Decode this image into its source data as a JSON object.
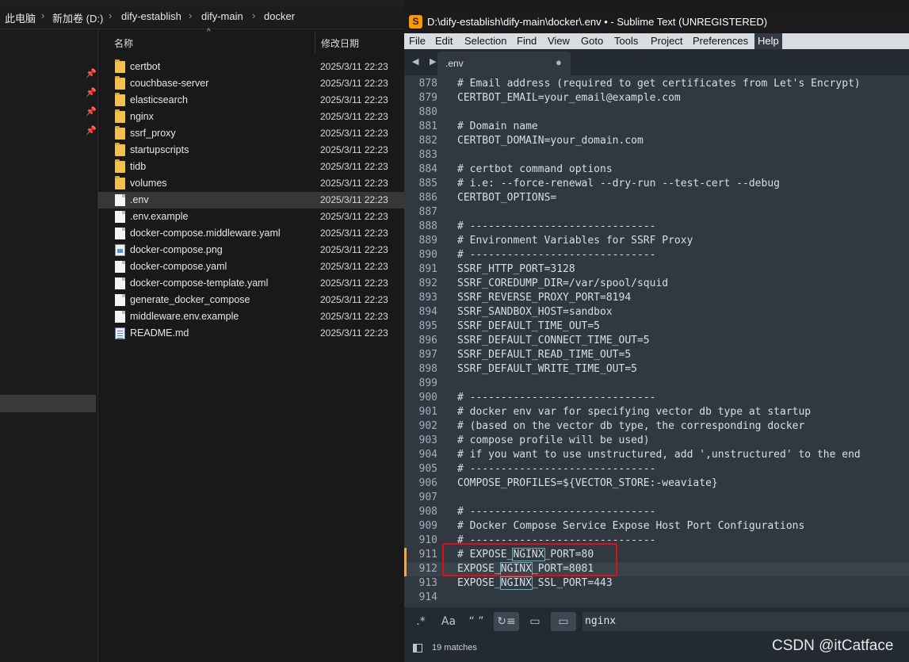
{
  "explorer": {
    "breadcrumb": [
      "此电脑",
      "新加卷 (D:)",
      "dify-establish",
      "dify-main",
      "docker"
    ],
    "columns": {
      "name": "名称",
      "date_modified": "修改日期"
    },
    "files": [
      {
        "name": "certbot",
        "date": "2025/3/11 22:23",
        "type": "folder"
      },
      {
        "name": "couchbase-server",
        "date": "2025/3/11 22:23",
        "type": "folder"
      },
      {
        "name": "elasticsearch",
        "date": "2025/3/11 22:23",
        "type": "folder"
      },
      {
        "name": "nginx",
        "date": "2025/3/11 22:23",
        "type": "folder"
      },
      {
        "name": "ssrf_proxy",
        "date": "2025/3/11 22:23",
        "type": "folder"
      },
      {
        "name": "startupscripts",
        "date": "2025/3/11 22:23",
        "type": "folder"
      },
      {
        "name": "tidb",
        "date": "2025/3/11 22:23",
        "type": "folder"
      },
      {
        "name": "volumes",
        "date": "2025/3/11 22:23",
        "type": "folder"
      },
      {
        "name": ".env",
        "date": "2025/3/11 22:23",
        "type": "file",
        "selected": true
      },
      {
        "name": ".env.example",
        "date": "2025/3/11 22:23",
        "type": "file"
      },
      {
        "name": "docker-compose.middleware.yaml",
        "date": "2025/3/11 22:23",
        "type": "file"
      },
      {
        "name": "docker-compose.png",
        "date": "2025/3/11 22:23",
        "type": "image"
      },
      {
        "name": "docker-compose.yaml",
        "date": "2025/3/11 22:23",
        "type": "file"
      },
      {
        "name": "docker-compose-template.yaml",
        "date": "2025/3/11 22:23",
        "type": "file"
      },
      {
        "name": "generate_docker_compose",
        "date": "2025/3/11 22:23",
        "type": "file"
      },
      {
        "name": "middleware.env.example",
        "date": "2025/3/11 22:23",
        "type": "file"
      },
      {
        "name": "README.md",
        "date": "2025/3/11 22:23",
        "type": "markdown"
      }
    ]
  },
  "sublime": {
    "title": "D:\\dify-establish\\dify-main\\docker\\.env • - Sublime Text (UNREGISTERED)",
    "app_icon": "S",
    "menu": [
      "File",
      "Edit",
      "Selection",
      "Find",
      "View",
      "Goto",
      "Tools",
      "Project",
      "Preferences",
      "Help"
    ],
    "tab": {
      "label": ".env",
      "dirty_marker": "●"
    },
    "nav_arrows": "◀ ▶",
    "search_term": "NGINX",
    "lines": [
      {
        "n": "878",
        "text": "# Email address (required to get certificates from Let's Encrypt)"
      },
      {
        "n": "879",
        "text": "CERTBOT_EMAIL=your_email@example.com"
      },
      {
        "n": "880",
        "text": ""
      },
      {
        "n": "881",
        "text": "# Domain name"
      },
      {
        "n": "882",
        "text": "CERTBOT_DOMAIN=your_domain.com"
      },
      {
        "n": "883",
        "text": ""
      },
      {
        "n": "884",
        "text": "# certbot command options"
      },
      {
        "n": "885",
        "text": "# i.e: --force-renewal --dry-run --test-cert --debug"
      },
      {
        "n": "886",
        "text": "CERTBOT_OPTIONS="
      },
      {
        "n": "887",
        "text": ""
      },
      {
        "n": "888",
        "text": "# ------------------------------"
      },
      {
        "n": "889",
        "text": "# Environment Variables for SSRF Proxy"
      },
      {
        "n": "890",
        "text": "# ------------------------------"
      },
      {
        "n": "891",
        "text": "SSRF_HTTP_PORT=3128"
      },
      {
        "n": "892",
        "text": "SSRF_COREDUMP_DIR=/var/spool/squid"
      },
      {
        "n": "893",
        "text": "SSRF_REVERSE_PROXY_PORT=8194"
      },
      {
        "n": "894",
        "text": "SSRF_SANDBOX_HOST=sandbox"
      },
      {
        "n": "895",
        "text": "SSRF_DEFAULT_TIME_OUT=5"
      },
      {
        "n": "896",
        "text": "SSRF_DEFAULT_CONNECT_TIME_OUT=5"
      },
      {
        "n": "897",
        "text": "SSRF_DEFAULT_READ_TIME_OUT=5"
      },
      {
        "n": "898",
        "text": "SSRF_DEFAULT_WRITE_TIME_OUT=5"
      },
      {
        "n": "899",
        "text": ""
      },
      {
        "n": "900",
        "text": "# ------------------------------"
      },
      {
        "n": "901",
        "text": "# docker env var for specifying vector db type at startup"
      },
      {
        "n": "902",
        "text": "# (based on the vector db type, the corresponding docker"
      },
      {
        "n": "903",
        "text": "# compose profile will be used)"
      },
      {
        "n": "904",
        "text": "# if you want to use unstructured, add ',unstructured' to the end"
      },
      {
        "n": "905",
        "text": "# ------------------------------"
      },
      {
        "n": "906",
        "text": "COMPOSE_PROFILES=${VECTOR_STORE:-weaviate}"
      },
      {
        "n": "907",
        "text": ""
      },
      {
        "n": "908",
        "text": "# ------------------------------"
      },
      {
        "n": "909",
        "text": "# Docker Compose Service Expose Host Port Configurations"
      },
      {
        "n": "910",
        "text": "# ------------------------------"
      },
      {
        "n": "911",
        "text": "# EXPOSE_NGINX_PORT=80",
        "dirty": true
      },
      {
        "n": "912",
        "text": "EXPOSE_NGINX_PORT=8081",
        "dirty": true,
        "current": true
      },
      {
        "n": "913",
        "text": "EXPOSE_NGINX_SSL_PORT=443"
      },
      {
        "n": "914",
        "text": ""
      }
    ],
    "find_panel": {
      "regex": ".*",
      "case": "Aa",
      "whole_word": "“ ”",
      "wrap": "↻≡",
      "in_selection": "▭",
      "highlight": "▭",
      "query": "nginx"
    },
    "status": "19 matches"
  },
  "watermark": "CSDN @itCatface"
}
